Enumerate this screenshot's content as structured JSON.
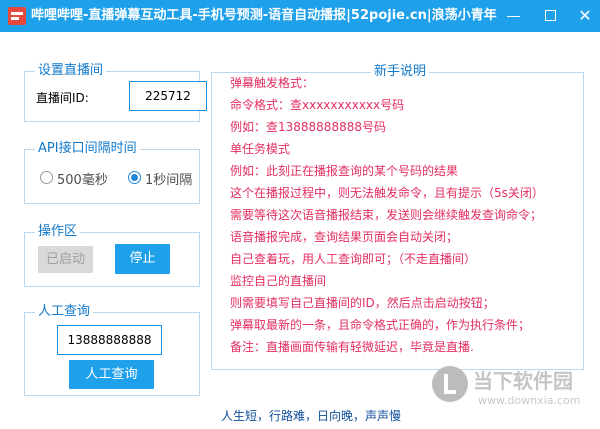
{
  "window": {
    "title": "哔哩哔哩-直播弹幕互动工具-手机号预测-语音自动播报|52pojie.cn|浪荡小青年",
    "minimize_glyph": "—",
    "maximize_glyph": "□",
    "close_glyph": "✕"
  },
  "live_room": {
    "legend": "设置直播间",
    "label": "直播间ID:",
    "value": "225712"
  },
  "api_interval": {
    "legend": "API接口间隔时间",
    "options": [
      {
        "label": "500毫秒",
        "checked": false
      },
      {
        "label": "1秒间隔",
        "checked": true
      }
    ]
  },
  "operations": {
    "legend": "操作区",
    "started_label": "已启动",
    "stop_label": "停止"
  },
  "manual_query": {
    "legend": "人工查询",
    "phone_value": "13888888888",
    "query_label": "人工查询"
  },
  "guide": {
    "legend": "新手说明",
    "lines": [
      "弹幕触发格式：",
      "命令格式：查xxxxxxxxxxx号码",
      "例如：查13888888888号码",
      "单任务模式",
      "例如：此刻正在播报查询的某个号码的结果",
      "这个在播报过程中，则无法触发命令，且有提示（5s关闭）",
      "需要等待这次语音播报结束，发送则会继续触发查询命令；",
      "语音播报完成，查询结果页面会自动关闭；",
      "自己查着玩，用人工查询即可；（不走直播间）",
      "监控自己的直播间",
      "则需要填写自己直播间的ID，然后点击启动按钮；",
      "弹幕取最新的一条，且命令格式正确的，作为执行条件；",
      "备注：直播画面传输有轻微延迟，毕竟是直播."
    ]
  },
  "footer": {
    "text": "人生短，行路难，日向晚，声声慢"
  },
  "watermark": {
    "text": "当下软件园",
    "url": "www.downxia.com"
  }
}
